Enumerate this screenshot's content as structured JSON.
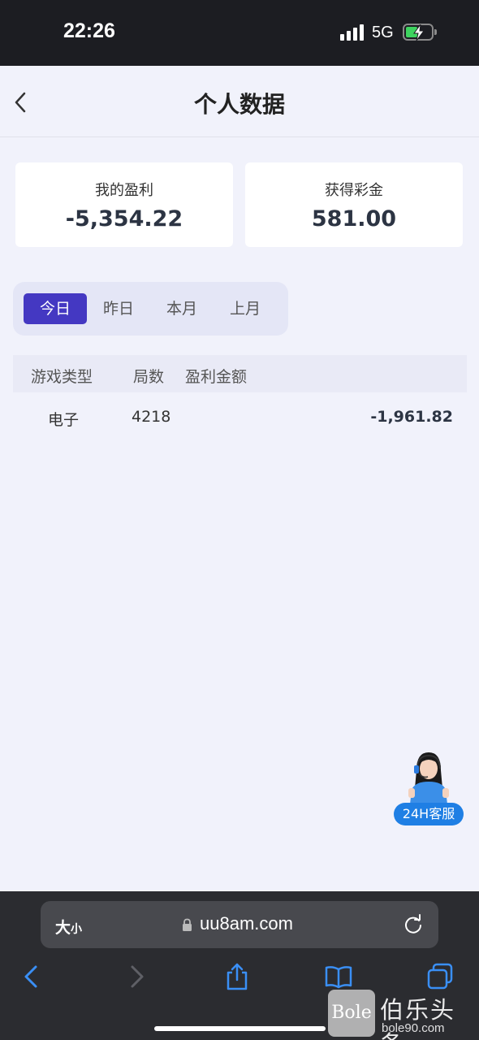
{
  "status": {
    "time": "22:26",
    "network": "5G"
  },
  "header": {
    "title": "个人数据"
  },
  "cards": [
    {
      "label": "我的盈利",
      "value": "-5,354.22"
    },
    {
      "label": "获得彩金",
      "value": "581.00"
    }
  ],
  "tabs": [
    {
      "label": "今日",
      "active": true
    },
    {
      "label": "昨日",
      "active": false
    },
    {
      "label": "本月",
      "active": false
    },
    {
      "label": "上月",
      "active": false
    }
  ],
  "table": {
    "headers": [
      "游戏类型",
      "局数",
      "盈利金额"
    ],
    "rows": [
      {
        "type": "电子",
        "count": "4218",
        "amount": "-1,961.82"
      }
    ]
  },
  "support": {
    "label": "24H客服"
  },
  "browser": {
    "text_size_big": "大",
    "text_size_small": "小",
    "url": "uu8am.com"
  },
  "watermark": {
    "logo": "Bole",
    "name": "伯乐头条",
    "url": "bole90.com"
  },
  "colors": {
    "accent": "#4438c2",
    "support_blue": "#1f7fe4",
    "background": "#f1f2fb"
  }
}
